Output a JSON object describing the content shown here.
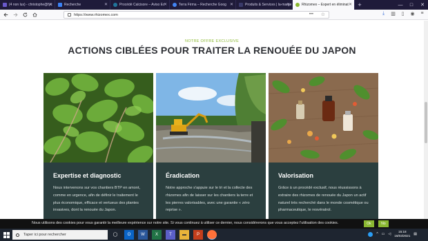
{
  "browser": {
    "tabs": [
      {
        "label": "(4 non lus) - christophe@fyc",
        "color": "#6a5acd",
        "active": false
      },
      {
        "label": "Recherche",
        "color": "#3b82f6",
        "active": false
      },
      {
        "label": "Procédé Calcisore – Aviso Ec",
        "color": "#21759b",
        "active": false
      },
      {
        "label": "Terra Firma – Recherche Goog",
        "color": "#4285f4",
        "active": false
      },
      {
        "label": "Produits & Services | la-marge",
        "color": "#3a3a6a",
        "active": false
      },
      {
        "label": "Rhizomex – Expert en éliminat",
        "color": "#8ab832",
        "active": true
      }
    ],
    "url": "https://www.rhizomex.com",
    "new_tab": "+",
    "window_controls": [
      "—",
      "□",
      "✕"
    ]
  },
  "page": {
    "eyebrow": "NOTRE OFFRE EXCLUSIVE",
    "heading": "ACTIONS CIBLÉES POUR TRAITER LA RENOUÉE DU JAPON",
    "cards": [
      {
        "title": "Expertise et diagnostic",
        "desc": "Nous intervenons sur vos chantiers BTP en amont, comme en urgence, afin de définir le traitement le plus économique, efficace et vertueux des plantes invasives, dont la renouée du Japon."
      },
      {
        "title": "Éradication",
        "desc": "Notre approche s'appuie sur le tri et la collecte des rhizomes afin de laisser sur les chantiers la terre et les pierres valorisables, avec une garantie « zéro reprise »."
      },
      {
        "title": "Valorisation",
        "desc": "Grâce à un procédé exclusif, nous réussissons à extraire des rhizomes de renouée du Japon un actif naturel très recherché dans le monde cosmétique ou pharmaceutique, le resvératrol."
      }
    ]
  },
  "cookie": {
    "message": "Nous utilisons des cookies pour vous garantir la meilleure expérience sur notre site. Si vous continuez à utiliser ce dernier, nous considérerons que vous acceptez l'utilisation des cookies.",
    "accept": "Ok",
    "refuse": "No"
  },
  "taskbar": {
    "search_placeholder": "Taper ici pour rechercher",
    "time": "15:18",
    "date": "16/03/2021"
  },
  "colors": {
    "accent": "#8ab832",
    "card_bg": "#2b3f3f",
    "heading": "#2d2f34"
  }
}
